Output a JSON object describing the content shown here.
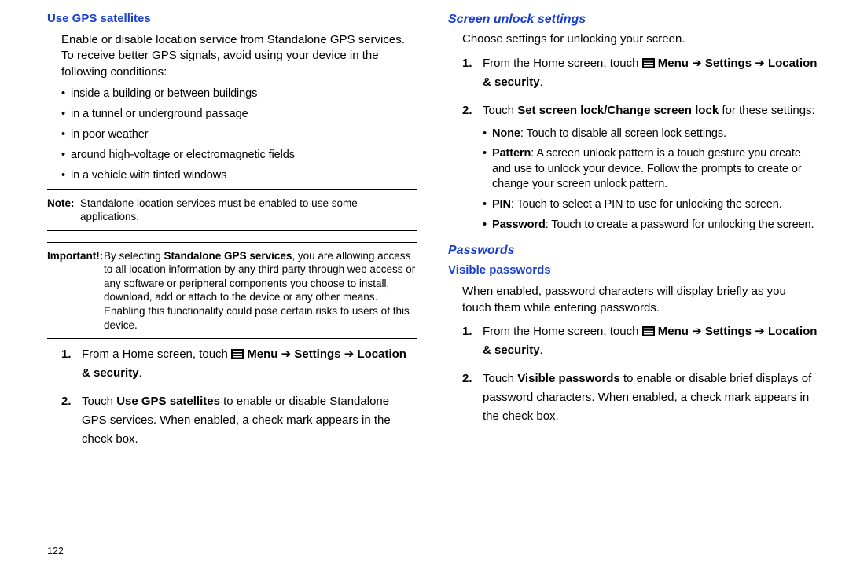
{
  "page_number": "122",
  "arrow": "➔",
  "left": {
    "h_gps": "Use GPS satellites",
    "gps_intro": "Enable or disable location service from Standalone GPS services. To receive better GPS signals, avoid using your device in the following conditions:",
    "gps_conditions": [
      "inside a building or between buildings",
      "in a tunnel or underground passage",
      "in poor weather",
      "around high-voltage or electromagnetic fields",
      "in a vehicle with tinted windows"
    ],
    "note_label": "Note:",
    "note_text": "Standalone location services must be enabled to use some applications.",
    "important_label": "Important!:",
    "important_pre": "By selecting ",
    "important_bold": "Standalone GPS services",
    "important_post": ", you are allowing access to all location information by any third party through web access or any software or peripheral components you choose to install, download, add or attach to the device or any other means. Enabling this functionality could pose certain risks to users of this device.",
    "step1_pre": "From a Home screen, touch ",
    "menu": "Menu",
    "settings": "Settings",
    "loc_sec": "Location & security",
    "step2_pre": "Touch ",
    "step2_bold": "Use GPS satellites",
    "step2_post": " to enable or disable Standalone GPS services. When enabled, a check mark appears in the check box."
  },
  "right": {
    "h_unlock": "Screen unlock settings",
    "unlock_intro": "Choose settings for unlocking your screen.",
    "step1_pre": "From the Home screen, touch ",
    "step2_pre": "Touch ",
    "step2_bold": "Set screen lock/Change screen lock",
    "step2_post": " for these settings:",
    "opts": {
      "none_b": "None",
      "none_t": ": Touch to disable all screen lock settings.",
      "pattern_b": "Pattern",
      "pattern_t": ": A screen unlock pattern is a touch gesture you create and use to unlock your device. Follow the prompts to create or change your screen unlock pattern.",
      "pin_b": "PIN",
      "pin_t": ": Touch to select a PIN to use for unlocking the screen.",
      "pw_b": "Password",
      "pw_t": ": Touch to create a password for unlocking the screen."
    },
    "h_passwords": "Passwords",
    "h_visible": "Visible passwords",
    "visible_intro": "When enabled, password characters will display briefly as you touch them while entering passwords.",
    "vp_step2_pre": "Touch ",
    "vp_step2_bold": "Visible passwords",
    "vp_step2_post": " to enable or disable brief displays of password characters. When enabled, a check mark appears in the check box."
  }
}
